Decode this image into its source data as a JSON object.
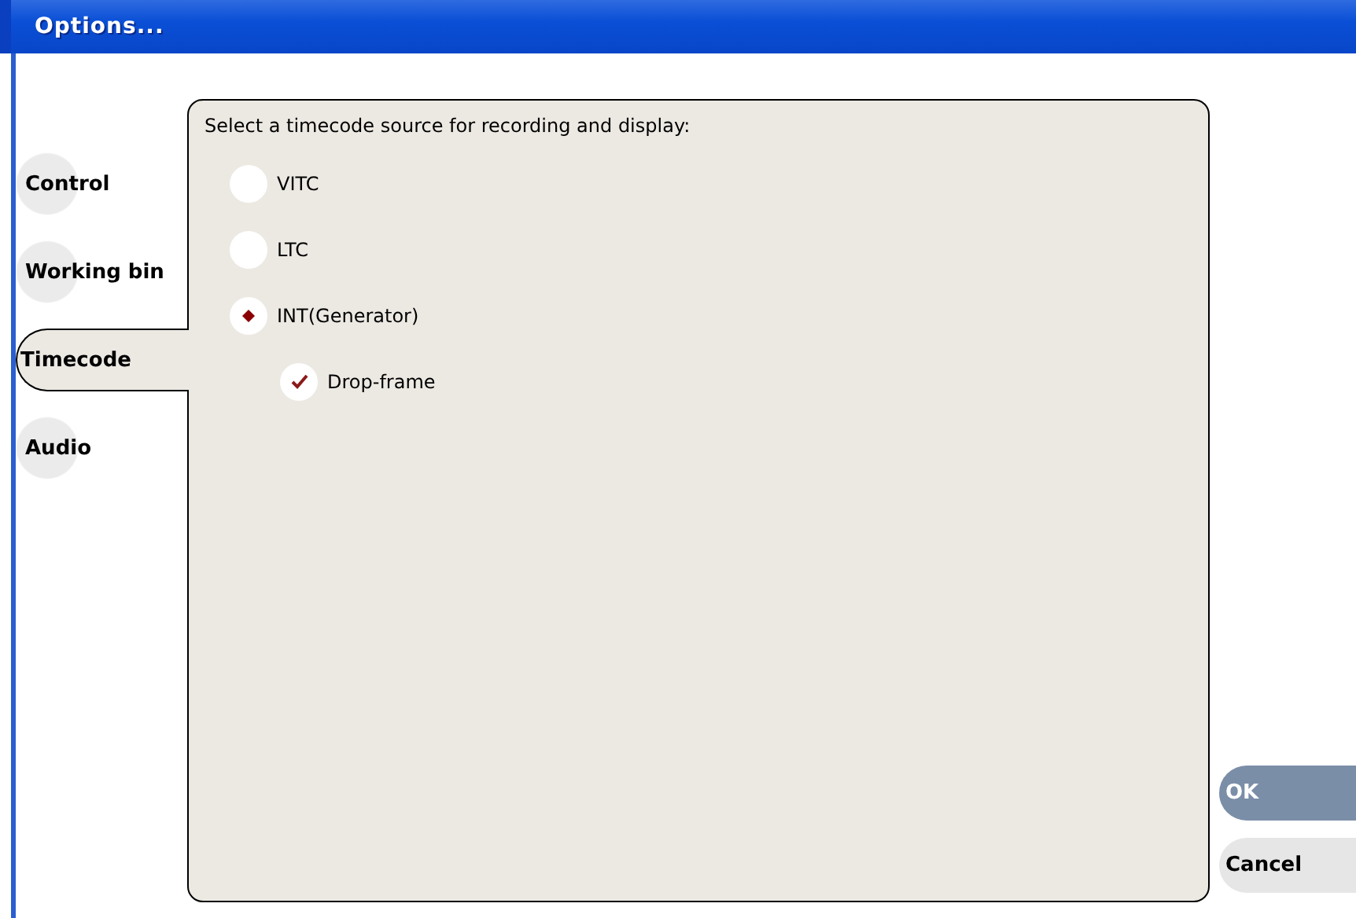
{
  "window": {
    "title": "Options..."
  },
  "tabs": [
    {
      "label": "Control",
      "selected": false
    },
    {
      "label": "Working bin",
      "selected": false
    },
    {
      "label": "Timecode",
      "selected": true
    },
    {
      "label": "Audio",
      "selected": false
    }
  ],
  "panel": {
    "heading": "Select a timecode source for recording and display:",
    "options": [
      {
        "kind": "radio",
        "label": "VITC",
        "selected": false
      },
      {
        "kind": "radio",
        "label": "LTC",
        "selected": false
      },
      {
        "kind": "radio",
        "label": "INT(Generator)",
        "selected": true
      },
      {
        "kind": "checkbox",
        "label": "Drop-frame",
        "checked": true
      }
    ]
  },
  "buttons": [
    {
      "label": "OK",
      "default": true
    },
    {
      "label": "Cancel",
      "default": false
    }
  ]
}
